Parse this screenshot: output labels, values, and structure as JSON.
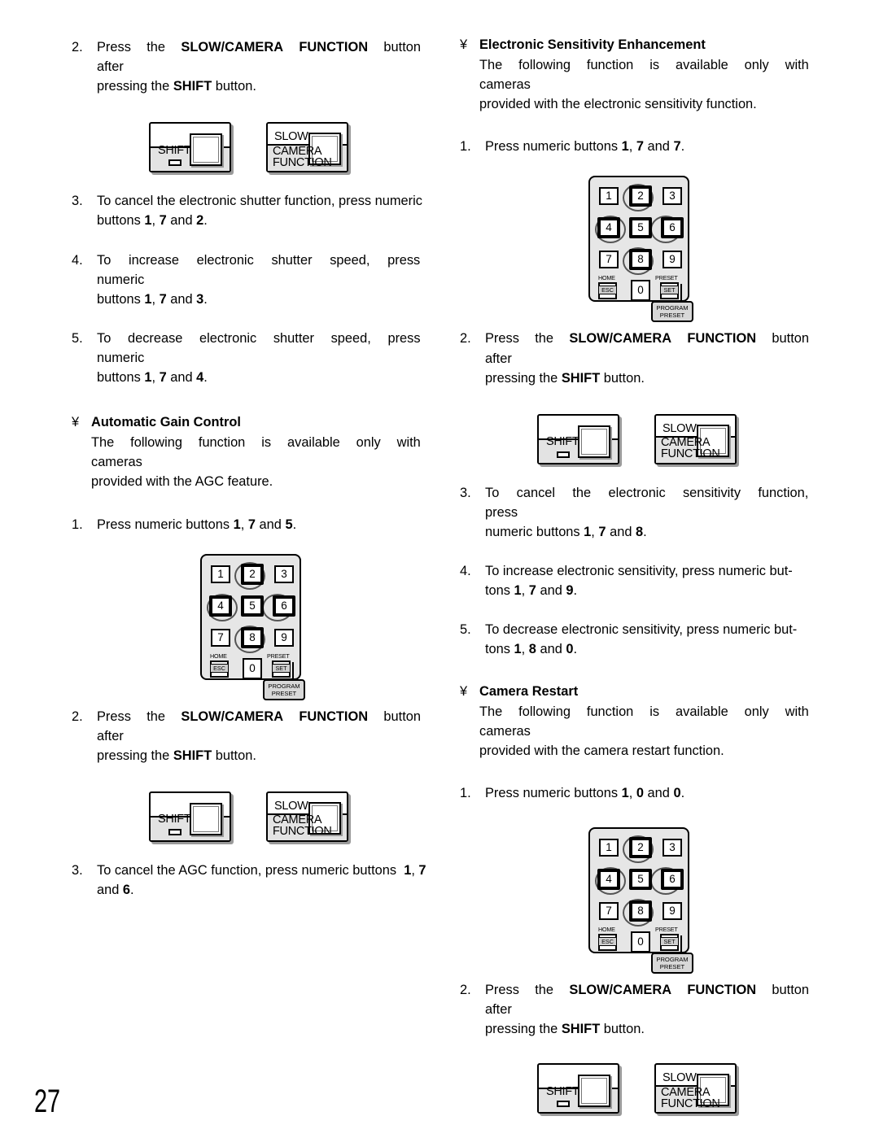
{
  "page": {
    "number": "27",
    "bullet_glyph": "¥"
  },
  "left_column": {
    "items": [
      {
        "type": "numitem",
        "num": "2.",
        "lines": [
          [
            {
              "t": "Press   the   ",
              "b": false
            },
            {
              "t": "SLOW/CAMERA   FUNCTION",
              "b": true
            },
            {
              "t": "   button   after",
              "b": false
            }
          ],
          [
            {
              "t": "pressing the ",
              "b": false
            },
            {
              "t": "SHIFT",
              "b": true
            },
            {
              "t": " button.",
              "b": false
            }
          ]
        ]
      },
      {
        "type": "figure-buttons",
        "name": "shift-slow-camera-function-figure-1"
      },
      {
        "type": "numitem",
        "num": "3.",
        "lines": [
          [
            {
              "t": "To cancel the electronic shutter function, press numeric",
              "b": false
            }
          ],
          [
            {
              "t": "buttons ",
              "b": false
            },
            {
              "t": "1",
              "b": true
            },
            {
              "t": ", ",
              "b": false
            },
            {
              "t": "7",
              "b": true
            },
            {
              "t": " and ",
              "b": false
            },
            {
              "t": "2",
              "b": true
            },
            {
              "t": ".",
              "b": false
            }
          ]
        ]
      },
      {
        "type": "numitem",
        "num": "4.",
        "lines": [
          [
            {
              "t": "To   increase   electronic   shutter   speed,   press   numeric",
              "b": false
            }
          ],
          [
            {
              "t": "buttons ",
              "b": false
            },
            {
              "t": "1",
              "b": true
            },
            {
              "t": ", ",
              "b": false
            },
            {
              "t": "7",
              "b": true
            },
            {
              "t": " and ",
              "b": false
            },
            {
              "t": "3",
              "b": true
            },
            {
              "t": ".",
              "b": false
            }
          ]
        ]
      },
      {
        "type": "numitem",
        "num": "5.",
        "lines": [
          [
            {
              "t": "To   decrease   electronic   shutter   speed,   press   numeric",
              "b": false
            }
          ],
          [
            {
              "t": "buttons ",
              "b": false
            },
            {
              "t": "1",
              "b": true
            },
            {
              "t": ", ",
              "b": false
            },
            {
              "t": "7",
              "b": true
            },
            {
              "t": " and ",
              "b": false
            },
            {
              "t": "4",
              "b": true
            },
            {
              "t": ".",
              "b": false
            }
          ]
        ]
      },
      {
        "type": "section",
        "heading": "Automatic Gain Control",
        "body_lines": [
          [
            {
              "t": "The   following   function   is   available   only   with   cameras",
              "b": false
            }
          ],
          [
            {
              "t": "provided with the AGC feature.",
              "b": false
            }
          ]
        ]
      },
      {
        "type": "numitem",
        "num": "1.",
        "lines": [
          [
            {
              "t": "Press numeric buttons ",
              "b": false
            },
            {
              "t": "1",
              "b": true
            },
            {
              "t": ", ",
              "b": false
            },
            {
              "t": "7",
              "b": true
            },
            {
              "t": " and ",
              "b": false
            },
            {
              "t": "5",
              "b": true
            },
            {
              "t": ".",
              "b": false
            }
          ]
        ]
      },
      {
        "type": "figure-keypad",
        "name": "numeric-keypad-figure-agc"
      },
      {
        "type": "numitem",
        "num": "2.",
        "lines": [
          [
            {
              "t": "Press   the   ",
              "b": false
            },
            {
              "t": "SLOW/CAMERA   FUNCTION",
              "b": true
            },
            {
              "t": "   button   after",
              "b": false
            }
          ],
          [
            {
              "t": "pressing the ",
              "b": false
            },
            {
              "t": "SHIFT",
              "b": true
            },
            {
              "t": " button.",
              "b": false
            }
          ]
        ]
      },
      {
        "type": "figure-buttons",
        "name": "shift-slow-camera-function-figure-2"
      },
      {
        "type": "numitem",
        "num": "3.",
        "lines": [
          [
            {
              "t": "To cancel the AGC function, press numeric buttons  ",
              "b": false
            },
            {
              "t": "1",
              "b": true
            },
            {
              "t": ", ",
              "b": false
            },
            {
              "t": "7",
              "b": true
            }
          ],
          [
            {
              "t": "and ",
              "b": false
            },
            {
              "t": "6",
              "b": true
            },
            {
              "t": ".",
              "b": false
            }
          ]
        ]
      }
    ]
  },
  "right_column": {
    "items": [
      {
        "type": "section",
        "heading": "Electronic Sensitivity Enhancement",
        "body_lines": [
          [
            {
              "t": "The   following   function   is   available   only   with   cameras",
              "b": false
            }
          ],
          [
            {
              "t": "provided with the electronic sensitivity function.",
              "b": false
            }
          ]
        ]
      },
      {
        "type": "numitem",
        "num": "1.",
        "lines": [
          [
            {
              "t": "Press numeric buttons ",
              "b": false
            },
            {
              "t": "1",
              "b": true
            },
            {
              "t": ", ",
              "b": false
            },
            {
              "t": "7",
              "b": true
            },
            {
              "t": " and ",
              "b": false
            },
            {
              "t": "7",
              "b": true
            },
            {
              "t": ".",
              "b": false
            }
          ]
        ]
      },
      {
        "type": "figure-keypad",
        "name": "numeric-keypad-figure-sensitivity"
      },
      {
        "type": "numitem",
        "num": "2.",
        "lines": [
          [
            {
              "t": "Press   the   ",
              "b": false
            },
            {
              "t": "SLOW/CAMERA   FUNCTION",
              "b": true
            },
            {
              "t": "   button   after",
              "b": false
            }
          ],
          [
            {
              "t": "pressing the ",
              "b": false
            },
            {
              "t": "SHIFT",
              "b": true
            },
            {
              "t": " button.",
              "b": false
            }
          ]
        ]
      },
      {
        "type": "figure-buttons",
        "name": "shift-slow-camera-function-figure-3"
      },
      {
        "type": "numitem",
        "num": "3.",
        "lines": [
          [
            {
              "t": "To   cancel   the   electronic   sensitivity   function,   press",
              "b": false
            }
          ],
          [
            {
              "t": "numeric buttons ",
              "b": false
            },
            {
              "t": "1",
              "b": true
            },
            {
              "t": ", ",
              "b": false
            },
            {
              "t": "7",
              "b": true
            },
            {
              "t": " and ",
              "b": false
            },
            {
              "t": "8",
              "b": true
            },
            {
              "t": ".",
              "b": false
            }
          ]
        ]
      },
      {
        "type": "numitem",
        "num": "4.",
        "lines": [
          [
            {
              "t": "To increase electronic sensitivity, press numeric but-",
              "b": false
            }
          ],
          [
            {
              "t": "tons ",
              "b": false
            },
            {
              "t": "1",
              "b": true
            },
            {
              "t": ", ",
              "b": false
            },
            {
              "t": "7",
              "b": true
            },
            {
              "t": " and ",
              "b": false
            },
            {
              "t": "9",
              "b": true
            },
            {
              "t": ".",
              "b": false
            }
          ]
        ]
      },
      {
        "type": "numitem",
        "num": "5.",
        "lines": [
          [
            {
              "t": "To decrease electronic sensitivity, press numeric but-",
              "b": false
            }
          ],
          [
            {
              "t": "tons ",
              "b": false
            },
            {
              "t": "1",
              "b": true
            },
            {
              "t": ", ",
              "b": false
            },
            {
              "t": "8",
              "b": true
            },
            {
              "t": " and ",
              "b": false
            },
            {
              "t": "0",
              "b": true
            },
            {
              "t": ".",
              "b": false
            }
          ]
        ]
      },
      {
        "type": "section",
        "heading": "Camera Restart",
        "body_lines": [
          [
            {
              "t": "The   following   function   is   available   only   with   cameras",
              "b": false
            }
          ],
          [
            {
              "t": "provided with the camera restart function.",
              "b": false
            }
          ]
        ]
      },
      {
        "type": "numitem",
        "num": "1.",
        "lines": [
          [
            {
              "t": "Press numeric buttons ",
              "b": false
            },
            {
              "t": "1",
              "b": true
            },
            {
              "t": ", ",
              "b": false
            },
            {
              "t": "0",
              "b": true
            },
            {
              "t": " and ",
              "b": false
            },
            {
              "t": "0",
              "b": true
            },
            {
              "t": ".",
              "b": false
            }
          ]
        ]
      },
      {
        "type": "figure-keypad",
        "name": "numeric-keypad-figure-restart"
      },
      {
        "type": "numitem",
        "num": "2.",
        "lines": [
          [
            {
              "t": "Press   the   ",
              "b": false
            },
            {
              "t": "SLOW/CAMERA   FUNCTION",
              "b": true
            },
            {
              "t": "   button   after",
              "b": false
            }
          ],
          [
            {
              "t": "pressing the ",
              "b": false
            },
            {
              "t": "SHIFT",
              "b": true
            },
            {
              "t": " button.",
              "b": false
            }
          ]
        ]
      },
      {
        "type": "figure-buttons",
        "name": "shift-slow-camera-function-figure-4"
      }
    ]
  },
  "button_figure": {
    "shift_label": "SHIFT",
    "slow_label": "SLOW",
    "camera_label": "CAMERA",
    "function_label": "FUNCTION"
  },
  "keypad_figure": {
    "keys": [
      "1",
      "2",
      "3",
      "4",
      "5",
      "6",
      "7",
      "8",
      "9"
    ],
    "ringed_keys": [
      "2",
      "4",
      "5",
      "6",
      "8"
    ],
    "zero_label": "0",
    "home_label": "HOME",
    "esc_label": "ESC",
    "preset_label": "PRESET",
    "set_label": "SET",
    "callout_line1": "PROGRAM",
    "callout_line2": "PRESET"
  }
}
